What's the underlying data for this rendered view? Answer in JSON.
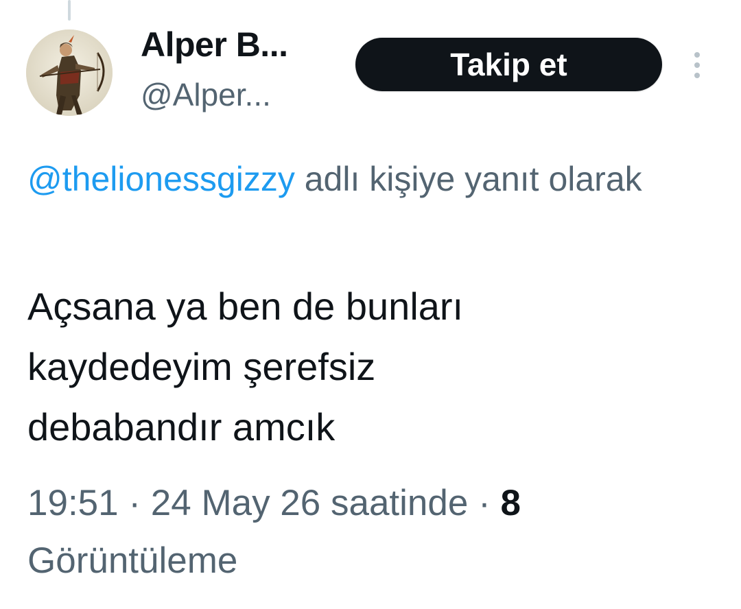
{
  "author": {
    "display_name": "Alper B...",
    "handle": "@Alper..."
  },
  "follow_button": {
    "label": "Takip et"
  },
  "reply_context": {
    "mention": "@thelionessgizzy",
    "suffix": "adlı kişiye yanıt olarak"
  },
  "tweet": {
    "lines": [
      "Açsana ya ben de bunları",
      "kaydedeyim şerefsiz",
      "debabandır amcık"
    ]
  },
  "meta": {
    "time": "19:51",
    "separator": "·",
    "date": "24 May 26 saatinde",
    "views_count": "8",
    "views_label": "Görüntüleme"
  },
  "icons": {
    "more": "more-vertical-icon",
    "avatar": "avatar-archer-image"
  },
  "colors": {
    "link": "#1d9bf0",
    "secondary_text": "#536471",
    "primary_text": "#0f1419",
    "button_bg": "#0f1419"
  }
}
